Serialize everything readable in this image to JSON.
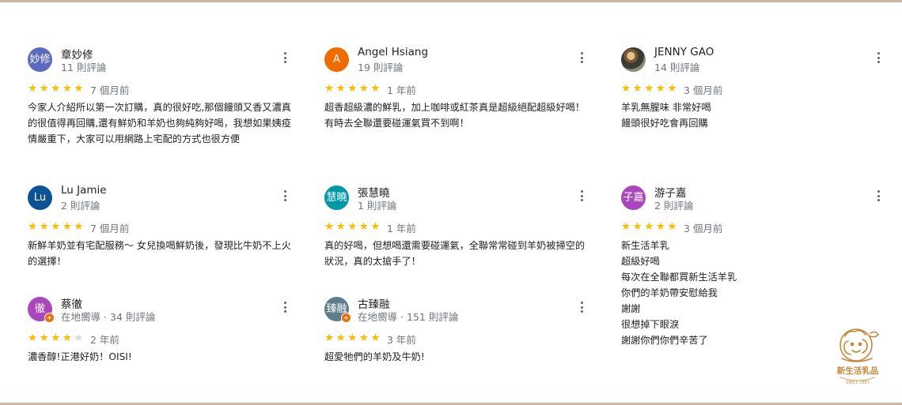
{
  "colors": {
    "star": "#fbbc04",
    "star_empty": "#dadce0",
    "meta_text": "#70757a",
    "local_guide_badge": "#e8710a",
    "logo": "#c48a3a"
  },
  "reviews": [
    {
      "name": "章妙修",
      "avatar_text": "妙修",
      "avatar_color": "#5c6bc0",
      "meta": "11 則評論",
      "local_guide": "",
      "stars": 5,
      "date": "7 個月前",
      "text": "今家人介紹所以第一次訂購，真的很好吃,那個饅頭又香又濃真的很值得再回購,還有鮮奶和羊奶也夠純夠好喝，我想如果姨疫情嚴重下，大家可以用網路上宅配的方式也很方便"
    },
    {
      "name": "Angel Hsiang",
      "avatar_text": "A",
      "avatar_color": "#ef6c00",
      "meta": "19 則評論",
      "local_guide": "",
      "stars": 5,
      "date": "1 年前",
      "text": "超香超級濃的鮮乳，加上咖啡或紅茶真是超級絕配超級好喝！有時去全聯還要碰運氣買不到啊！"
    },
    {
      "name": "JENNY GAO",
      "avatar_text": "",
      "avatar_color": "",
      "meta": "14 則評論",
      "local_guide": "",
      "stars": 5,
      "date": "3 個月前",
      "text": "羊乳無腥味 非常好喝\n饅頭很好吃會再回購"
    },
    {
      "name": "Lu Jamie",
      "avatar_text": "Lu",
      "avatar_color": "#0b5394",
      "meta": "2 則評論",
      "local_guide": "",
      "stars": 5,
      "date": "7 個月前",
      "text": "新鮮羊奶並有宅配服務～ 女兒換喝鮮奶後，發現比牛奶不上火的選擇！"
    },
    {
      "name": "張慧曉",
      "avatar_text": "慧曉",
      "avatar_color": "#0097a7",
      "meta": "1 則評論",
      "local_guide": "",
      "stars": 5,
      "date": "1 年前",
      "text": "真的好喝，但想喝還需要碰運氣，全聯常常碰到羊奶被掃空的狀況，真的太搶手了！"
    },
    {
      "name": "游子嘉",
      "avatar_text": "子嘉",
      "avatar_color": "#ab47bc",
      "meta": "2 則評論",
      "local_guide": "",
      "stars": 5,
      "date": "3 個月前",
      "text": "新生活羊乳\n超級好喝\n每次在全聯都買新生活羊乳\n你們的羊奶帶安慰給我\n謝謝\n很想掉下眼淚\n謝謝你們你們辛苦了"
    },
    {
      "name": "蔡徹",
      "avatar_text": "徹",
      "avatar_color": "#ab47bc",
      "meta": "34 則評論",
      "local_guide": "在地嚮導",
      "stars": 4,
      "date": "2 年前",
      "text": "濃香醇!正港好奶！OISI!"
    },
    {
      "name": "古臻融",
      "avatar_text": "臻融",
      "avatar_color": "#607d8b",
      "meta": "151 則評論",
      "local_guide": "在地嚮導",
      "stars": 5,
      "date": "3 年前",
      "text": "超愛牠們的羊奶及牛奶!"
    }
  ],
  "logo": {
    "name": "新生活乳品",
    "since": "SINCE 1987"
  },
  "icons": {
    "more": "more-vert-icon",
    "star": "star-icon",
    "badge": "local-guide-badge-icon"
  }
}
